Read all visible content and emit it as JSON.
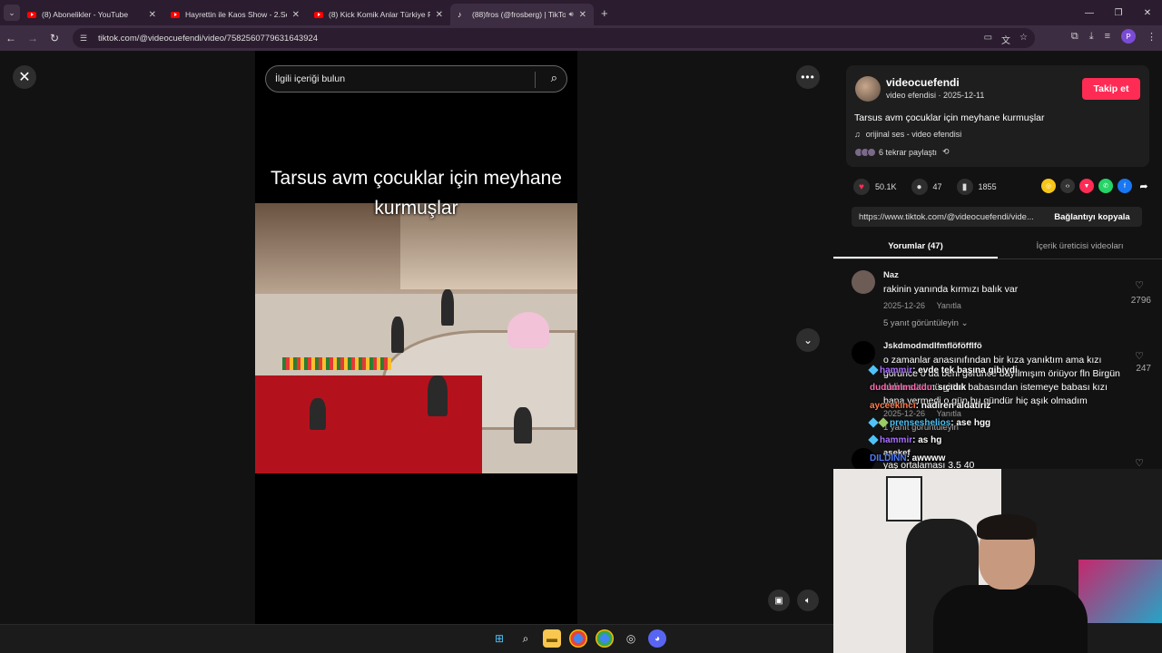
{
  "browser": {
    "tabs": [
      {
        "label": "(8) Abonelikler - YouTube",
        "icon": "youtube-icon"
      },
      {
        "label": "Hayrettin ile Kaos Show - 2.Sez",
        "icon": "youtube-icon"
      },
      {
        "label": "(8) Kick Komik Anlar Türkiye Re",
        "icon": "youtube-icon"
      },
      {
        "label": "(88)fros (@frosberg) | TikTo",
        "icon": "tiktok-icon",
        "active": true
      }
    ],
    "url": "tiktok.com/@videocuefendi/video/7582560779631643924",
    "profile_initial": "P"
  },
  "tiktok": {
    "search_placeholder": "İlgili içeriği bulun",
    "video_caption": "Tarsus avm çocuklar için meyhane kurmuşlar",
    "author": {
      "username": "videocuefendi",
      "subline": "video efendisi · 2025-12-11",
      "follow_label": "Takip et"
    },
    "description": "Tarsus avm çocuklar için meyhane kurmuşlar",
    "music": "orijinal ses - video efendisi",
    "reposts": "6 tekrar paylaştı",
    "likes": "50.1K",
    "comments_count": "47",
    "saves": "1855",
    "share_url": "https://www.tiktok.com/@videocuefendi/vide...",
    "copy_link_label": "Bağlantıyı kopyala",
    "tab_comments": "Yorumlar (47)",
    "tab_creator_videos": "İçerik üreticisi videoları",
    "comments": [
      {
        "name": "Naz",
        "text": "rakinin yanında kırmızı balık var",
        "date": "2025-12-26",
        "reply_label": "Yanıtla",
        "likes": "2796",
        "view_replies": "5 yanıt görüntüleyin"
      },
      {
        "name": "Jskdmodmdlfmflöföfflfö",
        "text": "o zamanlar anasınıfından bir kıza yanıktım ama kızı görünce o da beni görünce bayılmışım öriüyor fln Birgün aldim sütümü gittim babasından istemeye babası kızı bana vermedi o gün bu gündür hiç aşık olmadım",
        "date": "2025-12-26",
        "reply_label": "Yanıtla",
        "likes": "247",
        "view_replies": "1 yanıt görüntüleyin"
      },
      {
        "name": "asekef",
        "text": "yaş ortalaması 3.5 40"
      }
    ]
  },
  "chat": [
    {
      "user": "hammir",
      "msg": ": evde tek başına gibiydi",
      "color": "#a970ff"
    },
    {
      "user": "dudumlmdadu",
      "msg": ": sıçıdık",
      "color": "#ff69b4"
    },
    {
      "user": "ayceekinci",
      "msg": ": nadiren aldatiriz",
      "color": "#ff7f50"
    },
    {
      "user": "prenseshelios",
      "msg": ": ase hgg",
      "color": "#4fc3f7"
    },
    {
      "user": "hammir",
      "msg": ": as hg",
      "color": "#a970ff"
    },
    {
      "user": "DILDINN",
      "msg": ": awwww",
      "color": "#4f7dff"
    }
  ],
  "colors": {
    "accent": "#fe2c55",
    "background": "#121212"
  }
}
